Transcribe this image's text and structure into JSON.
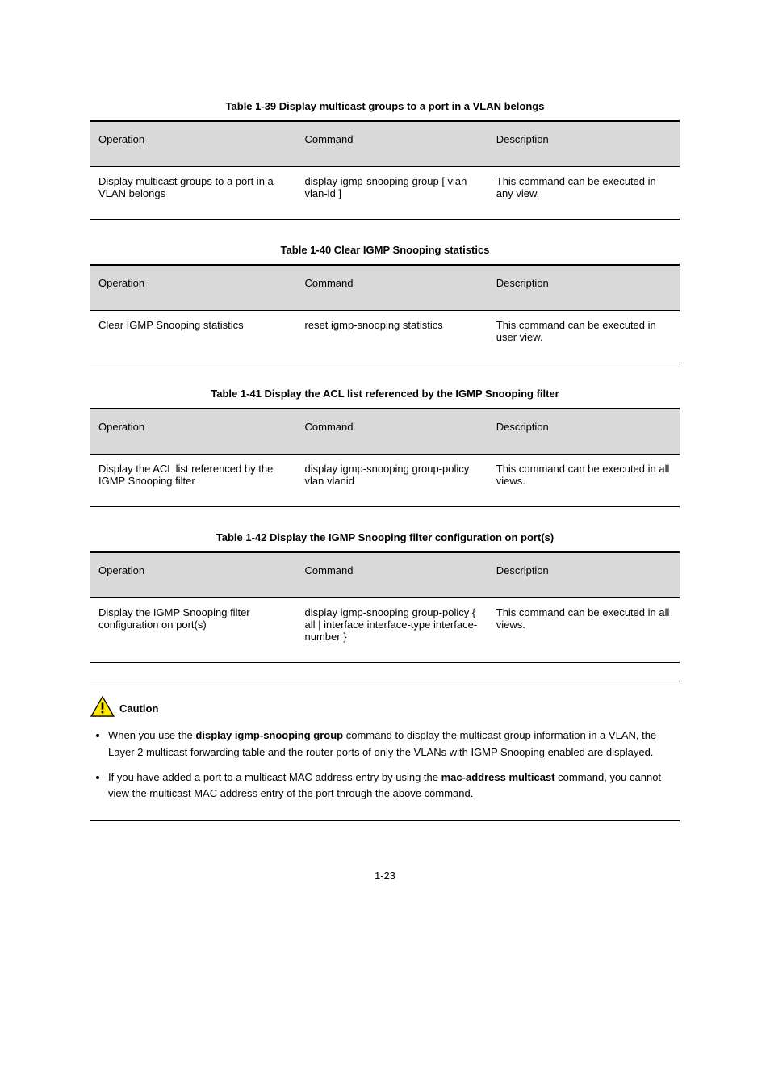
{
  "tables": [
    {
      "title": "Table 1-39 Display multicast groups to a port in a VLAN belongs",
      "h1": "Operation",
      "h2": "Command",
      "h3": "Description",
      "c1": "Display multicast groups to a port in a VLAN belongs",
      "c2": "display igmp-snooping group [ vlan vlan-id ]",
      "c3": "This command can be executed in any view."
    },
    {
      "title": "Table 1-40 Clear IGMP Snooping statistics",
      "h1": "Operation",
      "h2": "Command",
      "h3": "Description",
      "c1": "Clear IGMP Snooping statistics",
      "c2": "reset igmp-snooping statistics",
      "c3": "This command can be executed in user view."
    },
    {
      "title": "Table 1-41 Display the ACL list referenced by the IGMP Snooping filter",
      "h1": "Operation",
      "h2": "Command",
      "h3": "Description",
      "c1": "Display the ACL list referenced by the IGMP Snooping filter",
      "c2": "display igmp-snooping group-policy vlan vlanid",
      "c3": "This command can be executed in all views."
    },
    {
      "title": "Table 1-42 Display the IGMP Snooping filter configuration on port(s)",
      "h1": "Operation",
      "h2": "Command",
      "h3": "Description",
      "c1": "Display the IGMP Snooping filter configuration on port(s)",
      "c2": "display igmp-snooping group-policy { all | interface interface-type interface-number }",
      "c3": "This command can be executed in all views."
    }
  ],
  "caution": {
    "label": "Caution",
    "items": [
      {
        "pre": "When you use the ",
        "cmd": "display igmp-snooping group",
        "post": " command to display the multicast group information in a VLAN, the Layer 2 multicast forwarding table and the router ports of only the VLANs with IGMP Snooping enabled are displayed."
      },
      {
        "pre": "If you have added a port to a multicast MAC address entry by using the ",
        "cmd": "mac-address multicast",
        "post": " command, you cannot view the multicast MAC address entry of the port through the above command."
      }
    ]
  },
  "footer": "1-23"
}
